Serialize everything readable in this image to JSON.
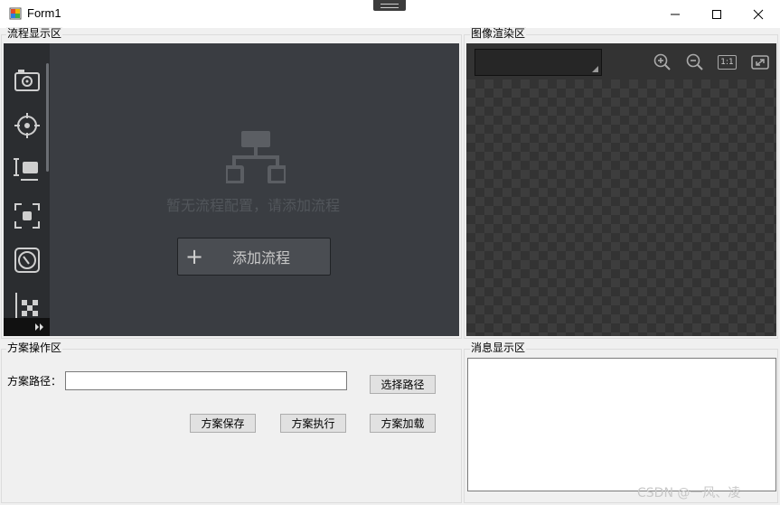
{
  "window": {
    "title": "Form1"
  },
  "flow_section": {
    "title": "流程显示区",
    "empty_message": "暂无流程配置，请添加流程",
    "add_button_label": "添加流程",
    "tools": [
      "camera-icon",
      "target-icon",
      "measure-icon",
      "focus-frame-icon",
      "clock-icon",
      "grid-calibration-icon"
    ]
  },
  "render_section": {
    "title": "图像渲染区",
    "combo_value": "",
    "tools": [
      "zoom-in-icon",
      "zoom-out-icon",
      "actual-size-icon",
      "fit-icon"
    ],
    "actual_size_label": "1:1"
  },
  "scheme_section": {
    "title": "方案操作区",
    "path_label": "方案路径：",
    "path_value": "",
    "select_path_label": "选择路径",
    "save_label": "方案保存",
    "execute_label": "方案执行",
    "load_label": "方案加载"
  },
  "message_section": {
    "title": "消息显示区"
  },
  "watermark": "CSDN @一风、凌"
}
